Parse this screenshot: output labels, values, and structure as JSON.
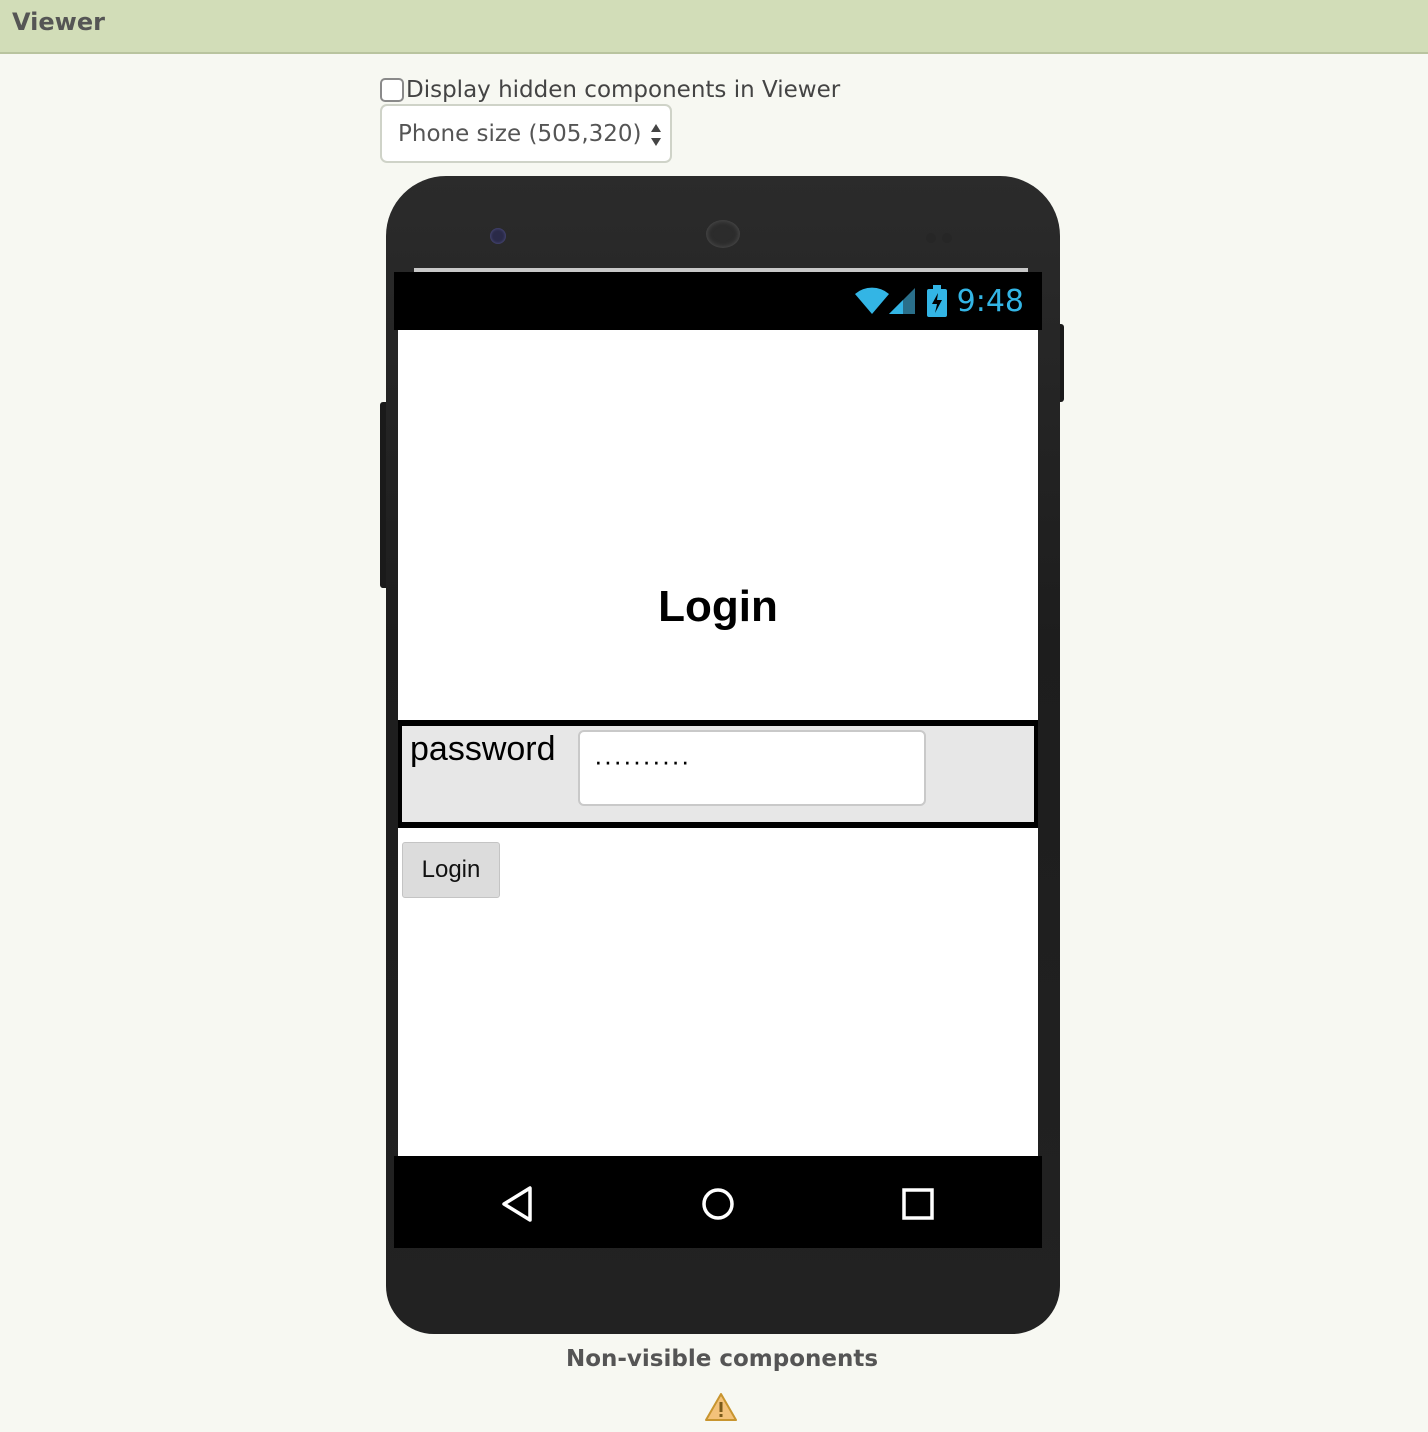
{
  "header": {
    "title": "Viewer"
  },
  "viewer_options": {
    "hidden_components_label": "Display hidden components in Viewer",
    "hidden_components_checked": false,
    "phone_size_selected": "Phone size (505,320)"
  },
  "status_bar": {
    "time": "9:48"
  },
  "app": {
    "title": "Login",
    "password_label": "password",
    "password_value": "··········",
    "login_button": "Login"
  },
  "footer": {
    "non_visible_title": "Non-visible components"
  },
  "colors": {
    "header_bg": "#d2ddb8",
    "page_bg": "#f7f8f2",
    "status_accent": "#33b5e5"
  }
}
